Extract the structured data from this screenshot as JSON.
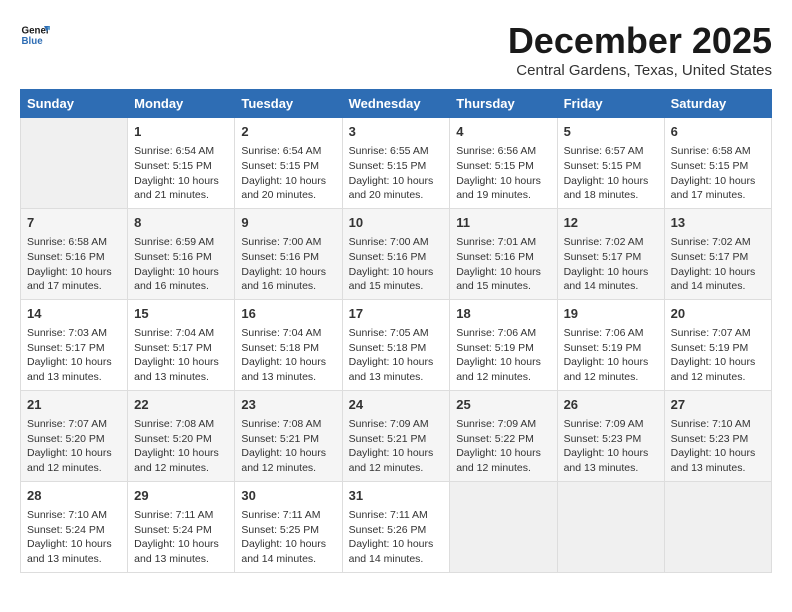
{
  "logo": {
    "line1": "General",
    "line2": "Blue"
  },
  "title": "December 2025",
  "subtitle": "Central Gardens, Texas, United States",
  "headers": [
    "Sunday",
    "Monday",
    "Tuesday",
    "Wednesday",
    "Thursday",
    "Friday",
    "Saturday"
  ],
  "weeks": [
    [
      {
        "day": "",
        "info": ""
      },
      {
        "day": "1",
        "info": "Sunrise: 6:54 AM\nSunset: 5:15 PM\nDaylight: 10 hours\nand 21 minutes."
      },
      {
        "day": "2",
        "info": "Sunrise: 6:54 AM\nSunset: 5:15 PM\nDaylight: 10 hours\nand 20 minutes."
      },
      {
        "day": "3",
        "info": "Sunrise: 6:55 AM\nSunset: 5:15 PM\nDaylight: 10 hours\nand 20 minutes."
      },
      {
        "day": "4",
        "info": "Sunrise: 6:56 AM\nSunset: 5:15 PM\nDaylight: 10 hours\nand 19 minutes."
      },
      {
        "day": "5",
        "info": "Sunrise: 6:57 AM\nSunset: 5:15 PM\nDaylight: 10 hours\nand 18 minutes."
      },
      {
        "day": "6",
        "info": "Sunrise: 6:58 AM\nSunset: 5:15 PM\nDaylight: 10 hours\nand 17 minutes."
      }
    ],
    [
      {
        "day": "7",
        "info": "Sunrise: 6:58 AM\nSunset: 5:16 PM\nDaylight: 10 hours\nand 17 minutes."
      },
      {
        "day": "8",
        "info": "Sunrise: 6:59 AM\nSunset: 5:16 PM\nDaylight: 10 hours\nand 16 minutes."
      },
      {
        "day": "9",
        "info": "Sunrise: 7:00 AM\nSunset: 5:16 PM\nDaylight: 10 hours\nand 16 minutes."
      },
      {
        "day": "10",
        "info": "Sunrise: 7:00 AM\nSunset: 5:16 PM\nDaylight: 10 hours\nand 15 minutes."
      },
      {
        "day": "11",
        "info": "Sunrise: 7:01 AM\nSunset: 5:16 PM\nDaylight: 10 hours\nand 15 minutes."
      },
      {
        "day": "12",
        "info": "Sunrise: 7:02 AM\nSunset: 5:17 PM\nDaylight: 10 hours\nand 14 minutes."
      },
      {
        "day": "13",
        "info": "Sunrise: 7:02 AM\nSunset: 5:17 PM\nDaylight: 10 hours\nand 14 minutes."
      }
    ],
    [
      {
        "day": "14",
        "info": "Sunrise: 7:03 AM\nSunset: 5:17 PM\nDaylight: 10 hours\nand 13 minutes."
      },
      {
        "day": "15",
        "info": "Sunrise: 7:04 AM\nSunset: 5:17 PM\nDaylight: 10 hours\nand 13 minutes."
      },
      {
        "day": "16",
        "info": "Sunrise: 7:04 AM\nSunset: 5:18 PM\nDaylight: 10 hours\nand 13 minutes."
      },
      {
        "day": "17",
        "info": "Sunrise: 7:05 AM\nSunset: 5:18 PM\nDaylight: 10 hours\nand 13 minutes."
      },
      {
        "day": "18",
        "info": "Sunrise: 7:06 AM\nSunset: 5:19 PM\nDaylight: 10 hours\nand 12 minutes."
      },
      {
        "day": "19",
        "info": "Sunrise: 7:06 AM\nSunset: 5:19 PM\nDaylight: 10 hours\nand 12 minutes."
      },
      {
        "day": "20",
        "info": "Sunrise: 7:07 AM\nSunset: 5:19 PM\nDaylight: 10 hours\nand 12 minutes."
      }
    ],
    [
      {
        "day": "21",
        "info": "Sunrise: 7:07 AM\nSunset: 5:20 PM\nDaylight: 10 hours\nand 12 minutes."
      },
      {
        "day": "22",
        "info": "Sunrise: 7:08 AM\nSunset: 5:20 PM\nDaylight: 10 hours\nand 12 minutes."
      },
      {
        "day": "23",
        "info": "Sunrise: 7:08 AM\nSunset: 5:21 PM\nDaylight: 10 hours\nand 12 minutes."
      },
      {
        "day": "24",
        "info": "Sunrise: 7:09 AM\nSunset: 5:21 PM\nDaylight: 10 hours\nand 12 minutes."
      },
      {
        "day": "25",
        "info": "Sunrise: 7:09 AM\nSunset: 5:22 PM\nDaylight: 10 hours\nand 12 minutes."
      },
      {
        "day": "26",
        "info": "Sunrise: 7:09 AM\nSunset: 5:23 PM\nDaylight: 10 hours\nand 13 minutes."
      },
      {
        "day": "27",
        "info": "Sunrise: 7:10 AM\nSunset: 5:23 PM\nDaylight: 10 hours\nand 13 minutes."
      }
    ],
    [
      {
        "day": "28",
        "info": "Sunrise: 7:10 AM\nSunset: 5:24 PM\nDaylight: 10 hours\nand 13 minutes."
      },
      {
        "day": "29",
        "info": "Sunrise: 7:11 AM\nSunset: 5:24 PM\nDaylight: 10 hours\nand 13 minutes."
      },
      {
        "day": "30",
        "info": "Sunrise: 7:11 AM\nSunset: 5:25 PM\nDaylight: 10 hours\nand 14 minutes."
      },
      {
        "day": "31",
        "info": "Sunrise: 7:11 AM\nSunset: 5:26 PM\nDaylight: 10 hours\nand 14 minutes."
      },
      {
        "day": "",
        "info": ""
      },
      {
        "day": "",
        "info": ""
      },
      {
        "day": "",
        "info": ""
      }
    ]
  ]
}
